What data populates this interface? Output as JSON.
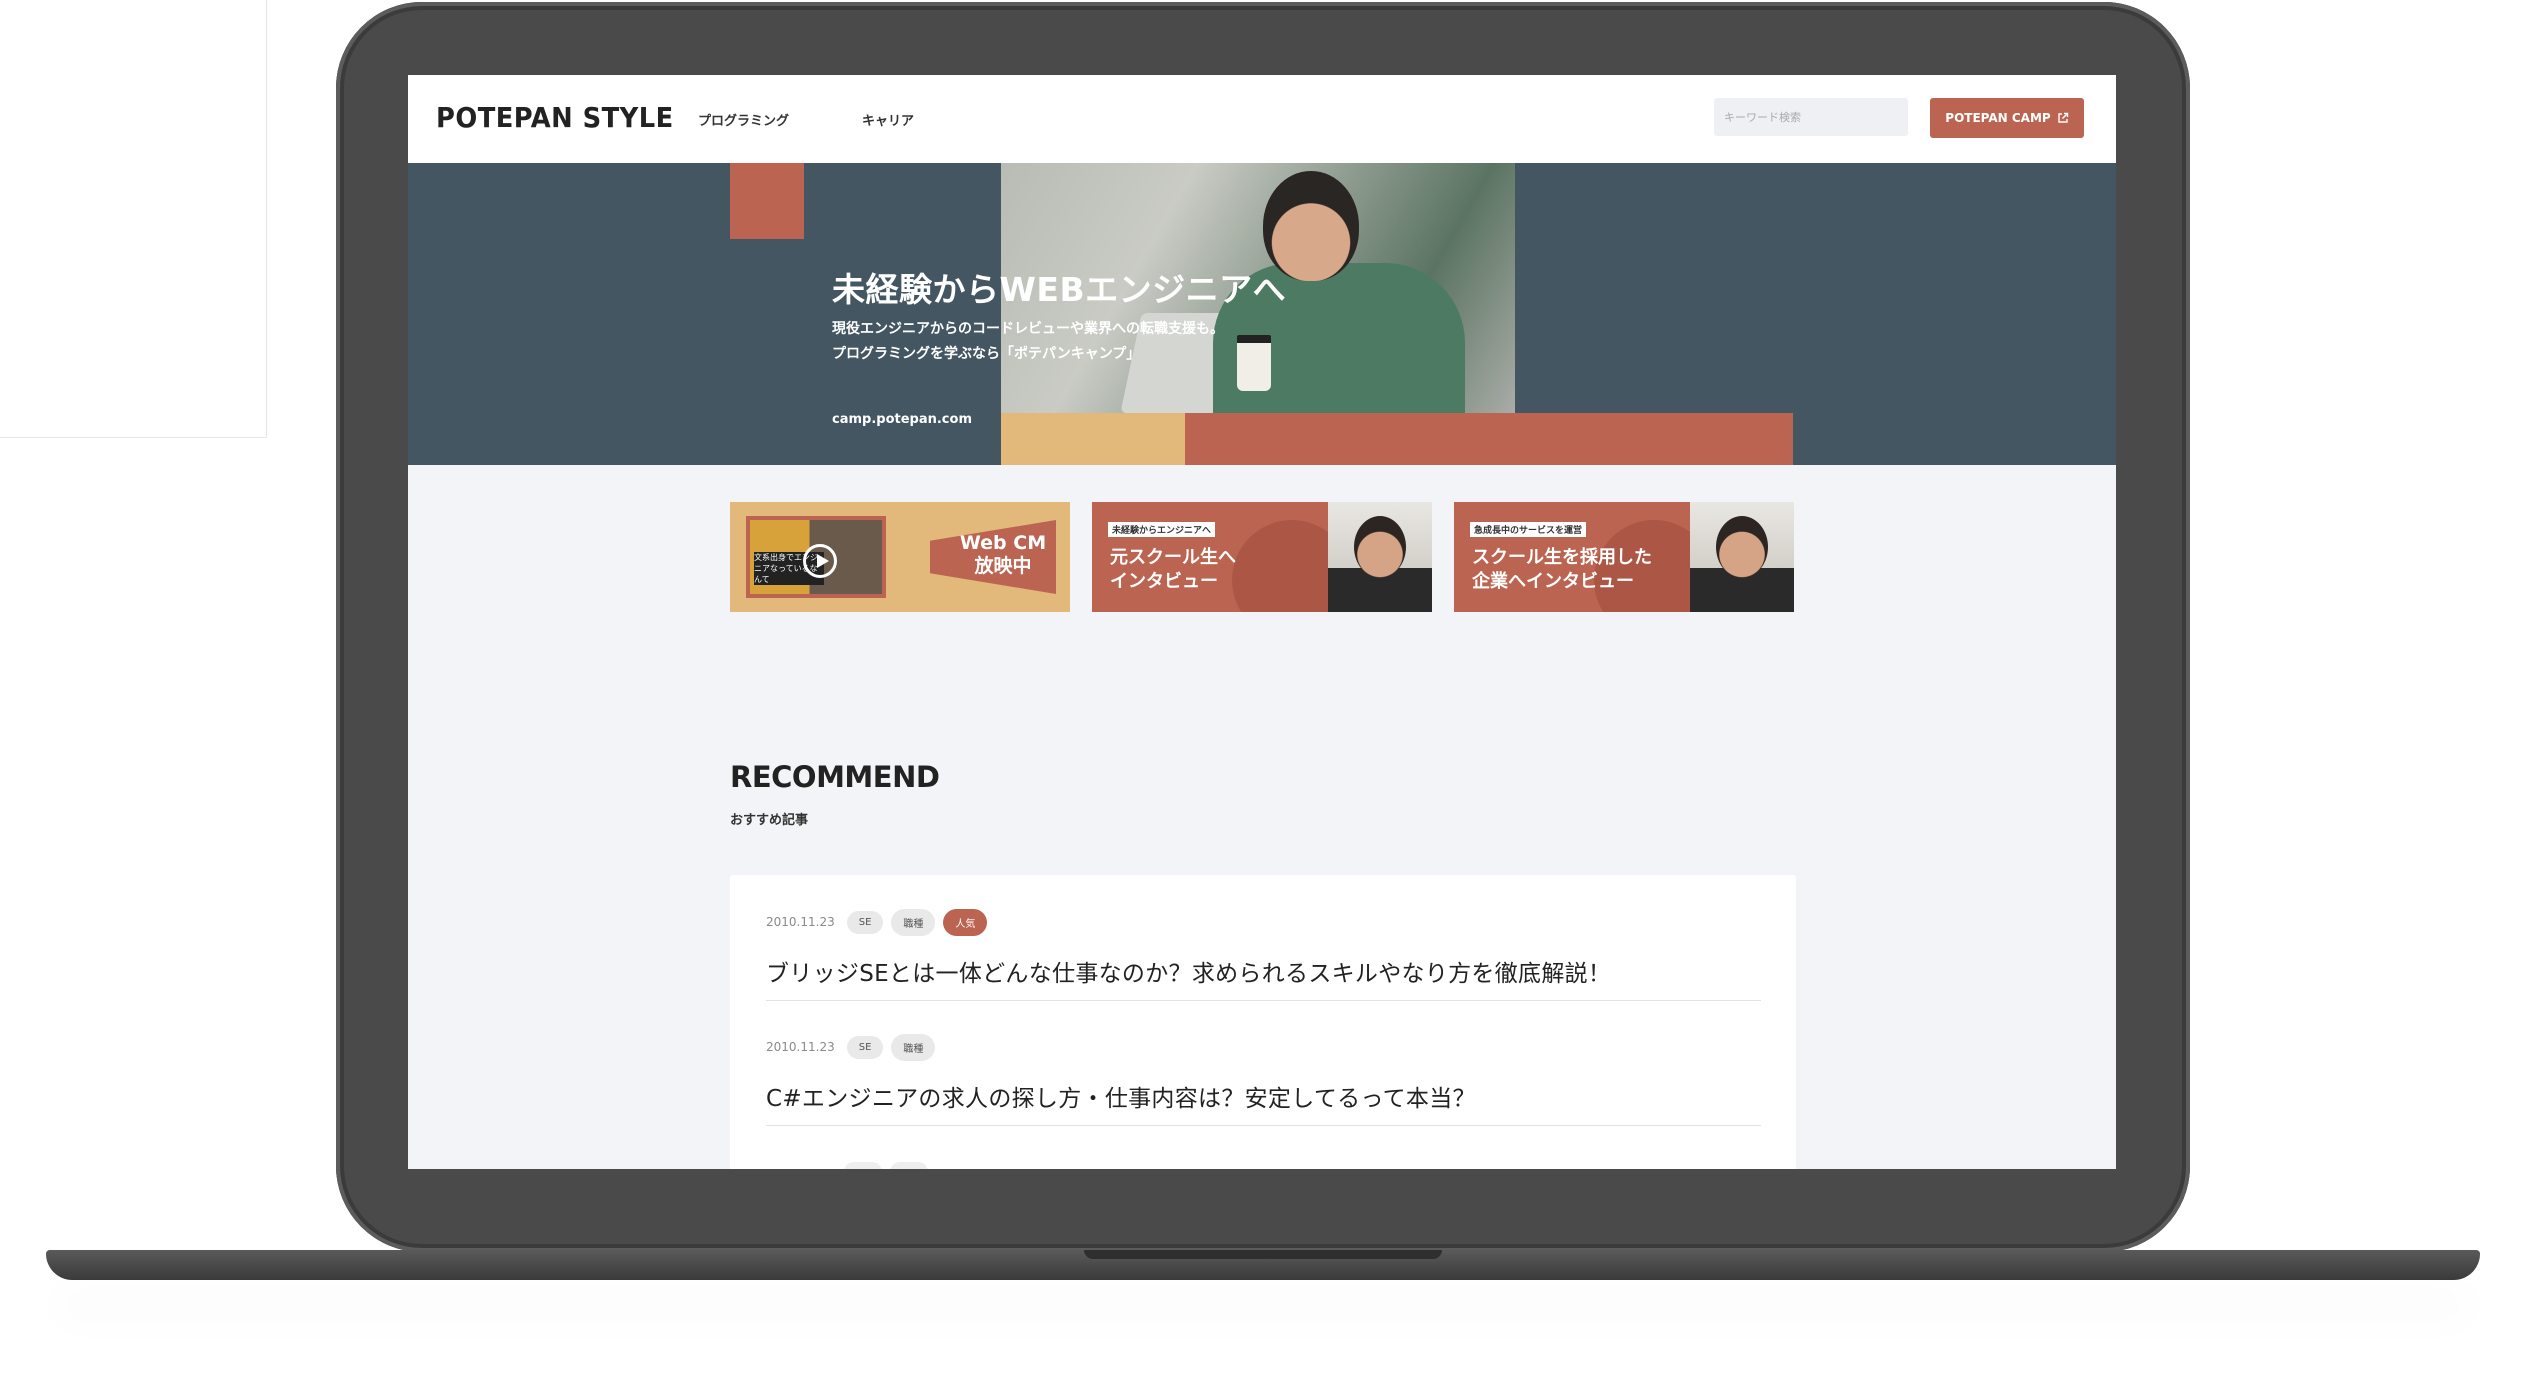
{
  "header": {
    "logo": "POTEPAN STYLE",
    "nav": [
      "プログラミング",
      "キャリア"
    ],
    "search_placeholder": "キーワード検索",
    "camp_button": "POTEPAN CAMP"
  },
  "hero": {
    "title": "未経験からWEBエンジニアへ",
    "subtitle_line1": "現役エンジニアからのコードレビューや業界への転職支援も。",
    "subtitle_line2": "プログラミングを学ぶなら「ポテパンキャンプ」",
    "url": "camp.potepan.com"
  },
  "banners": [
    {
      "video_caption": "文系出身でエンジニアなっているなんて",
      "text_line1": "Web CM",
      "text_line2": "放映中"
    },
    {
      "tag": "未経験からエンジニアへ",
      "title_line1": "元スクール生へ",
      "title_line2": "インタビュー"
    },
    {
      "tag": "急成長中のサービスを運営",
      "title_line1": "スクール生を採用した",
      "title_line2": "企業へインタビュー"
    }
  ],
  "recommend": {
    "title": "RECOMMEND",
    "subtitle": "おすすめ記事",
    "articles": [
      {
        "date": "2010.11.23",
        "tags": [
          "SE",
          "職種"
        ],
        "hot_tag": "人気",
        "title": "ブリッジSEとは一体どんな仕事なのか？求められるスキルやなり方を徹底解説！"
      },
      {
        "date": "2010.11.23",
        "tags": [
          "SE",
          "職種"
        ],
        "title": "C#エンジニアの求人の探し方・仕事内容は？安定してるって本当？"
      }
    ]
  },
  "colors": {
    "accent": "#bb6451",
    "hero_bg": "#435661",
    "yellow": "#e3b87b",
    "page_bg": "#f3f4f7",
    "bezel": "#4a4a4a"
  },
  "icons": [
    "external-link-icon",
    "play-icon"
  ]
}
